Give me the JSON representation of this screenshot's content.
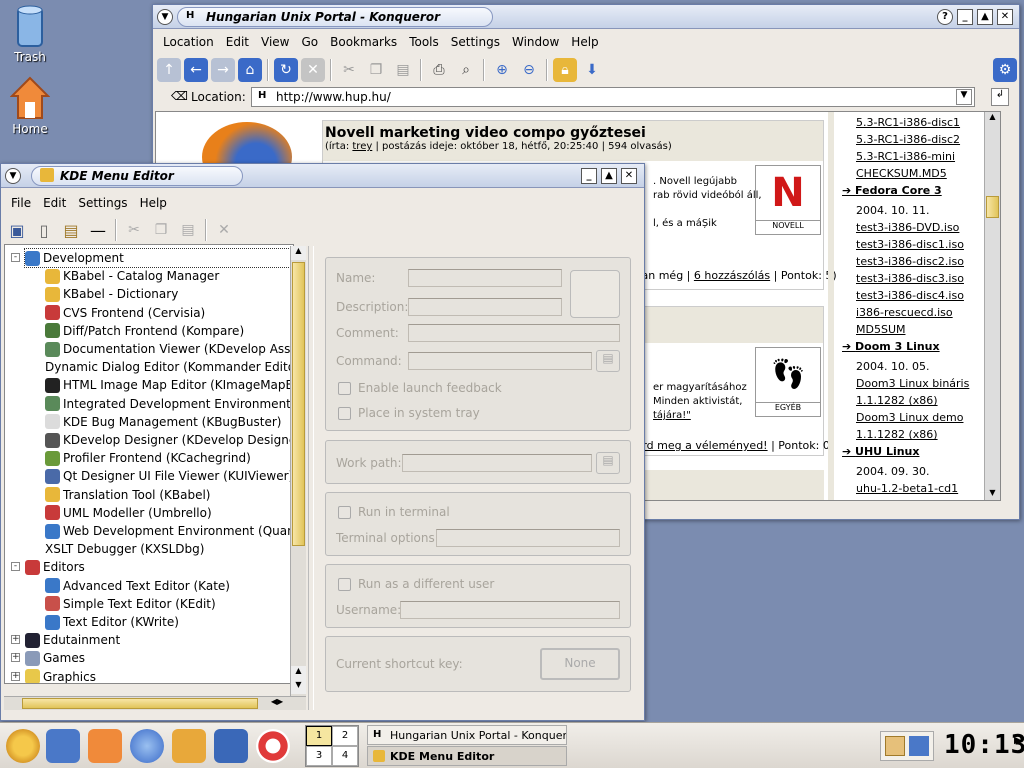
{
  "desktop": {
    "trash_label": "Trash",
    "home_label": "Home"
  },
  "konqueror": {
    "title": "Hungarian Unix Portal - Konqueror",
    "menu": [
      "Location",
      "Edit",
      "View",
      "Go",
      "Bookmarks",
      "Tools",
      "Settings",
      "Window",
      "Help"
    ],
    "location_label": "Location:",
    "url": "http://www.hup.hu/",
    "article1": {
      "title": "Novell marketing video compo győztesei",
      "meta_prefix": "(írta: ",
      "author": "trey",
      "meta_suffix": " | postázás ideje: október 18, hétfő, 20:25:40 | 594 olvasás)",
      "line1": ". Novell legújabb",
      "line2": "rab rövid videóból áll,",
      "line3": "l, és a máȘik",
      "badge": "NOVELL",
      "footer_prefix": "van még | ",
      "comments": "6 hozzászólás",
      "footer_suffix": " | Pontok: 5)"
    },
    "article2": {
      "title_tail": "s)",
      "line1": "er magyarításához",
      "line2": "Minden aktivistát,",
      "line3": "tájára!\"",
      "badge": "EGYÉB",
      "comment_link": "írd meg a véleményed!",
      "footer_suffix": " | Pontok: 0)",
      "tail": "e)"
    },
    "sidebar": {
      "items": [
        {
          "text": "5.3-RC1-i386-disc1",
          "type": "link"
        },
        {
          "text": "5.3-RC1-i386-disc2",
          "type": "link"
        },
        {
          "text": "5.3-RC1-i386-mini",
          "type": "link"
        },
        {
          "text": "CHECKSUM.MD5",
          "type": "link"
        },
        {
          "text": "Fedora Core 3",
          "type": "head"
        },
        {
          "text": "2004. 10. 11.",
          "type": "date"
        },
        {
          "text": "test3-i386-DVD.iso",
          "type": "link"
        },
        {
          "text": "test3-i386-disc1.iso",
          "type": "link"
        },
        {
          "text": "test3-i386-disc2.iso",
          "type": "link"
        },
        {
          "text": "test3-i386-disc3.iso",
          "type": "link"
        },
        {
          "text": "test3-i386-disc4.iso",
          "type": "link"
        },
        {
          "text": "i386-rescuecd.iso",
          "type": "link"
        },
        {
          "text": "MD5SUM",
          "type": "link"
        },
        {
          "text": "Doom 3 Linux",
          "type": "head"
        },
        {
          "text": "2004. 10. 05.",
          "type": "date"
        },
        {
          "text": "Doom3 Linux bináris",
          "type": "link"
        },
        {
          "text": "1.1.1282 (x86)",
          "type": "link"
        },
        {
          "text": "Doom3 Linux demo",
          "type": "link"
        },
        {
          "text": "1.1.1282 (x86)",
          "type": "link"
        },
        {
          "text": "UHU Linux",
          "type": "head"
        },
        {
          "text": "2004. 09. 30.",
          "type": "date"
        },
        {
          "text": "uhu-1.2-beta1-cd1",
          "type": "link"
        }
      ]
    }
  },
  "kmenuedit": {
    "title": "KDE Menu Editor",
    "menu": [
      "File",
      "Edit",
      "Settings",
      "Help"
    ],
    "tree": [
      {
        "label": "Development",
        "level": 0,
        "expander": "-",
        "color": "#3a78c8",
        "selected": true
      },
      {
        "label": "KBabel - Catalog Manager",
        "level": 1,
        "color": "#e8b73a"
      },
      {
        "label": "KBabel - Dictionary",
        "level": 1,
        "color": "#e8b73a"
      },
      {
        "label": "CVS Frontend (Cervisia)",
        "level": 1,
        "color": "#c83a3a"
      },
      {
        "label": "Diff/Patch Frontend (Kompare)",
        "level": 1,
        "color": "#4a7a3a"
      },
      {
        "label": "Documentation Viewer (KDevelop Assist",
        "level": 1,
        "color": "#5a8a5a"
      },
      {
        "label": "Dynamic Dialog Editor (Kommander Editor)",
        "level": 1,
        "color": ""
      },
      {
        "label": "HTML Image Map Editor (KImageMapEdi",
        "level": 1,
        "color": "#222"
      },
      {
        "label": "Integrated Development Environment (KD",
        "level": 1,
        "color": "#5a8a5a"
      },
      {
        "label": "KDE Bug Management (KBugBuster)",
        "level": 1,
        "color": "#dcdcdc"
      },
      {
        "label": "KDevelop Designer (KDevelop Designer",
        "level": 1,
        "color": "#555"
      },
      {
        "label": "Profiler Frontend (KCachegrind)",
        "level": 1,
        "color": "#6a9a3a"
      },
      {
        "label": "Qt Designer UI File Viewer (KUIViewer)",
        "level": 1,
        "color": "#4a6aa8"
      },
      {
        "label": "Translation Tool (KBabel)",
        "level": 1,
        "color": "#e8b73a"
      },
      {
        "label": "UML Modeller (Umbrello)",
        "level": 1,
        "color": "#c83a3a"
      },
      {
        "label": "Web Development Environment (Quanta",
        "level": 1,
        "color": "#3a78c8"
      },
      {
        "label": "XSLT Debugger (KXSLDbg)",
        "level": 1,
        "color": ""
      },
      {
        "label": "Editors",
        "level": 0,
        "expander": "-",
        "color": "#c83a3a"
      },
      {
        "label": "Advanced Text Editor (Kate)",
        "level": 1,
        "color": "#3a78c8"
      },
      {
        "label": "Simple Text Editor (KEdit)",
        "level": 1,
        "color": "#c8504a"
      },
      {
        "label": "Text Editor (KWrite)",
        "level": 1,
        "color": "#3a78c8"
      },
      {
        "label": "Edutainment",
        "level": 0,
        "expander": "+",
        "color": "#223"
      },
      {
        "label": "Games",
        "level": 0,
        "expander": "+",
        "color": "#8a9ab8"
      },
      {
        "label": "Graphics",
        "level": 0,
        "expander": "+",
        "color": "#e8c84a"
      },
      {
        "label": "Internet",
        "level": 0,
        "expander": "+",
        "color": "#3a68b8"
      }
    ],
    "form": {
      "name_label": "Name:",
      "description_label": "Description:",
      "comment_label": "Comment:",
      "command_label": "Command:",
      "launch_feedback_label": "Enable launch feedback",
      "system_tray_label": "Place in system tray",
      "work_path_label": "Work path:",
      "run_terminal_label": "Run in terminal",
      "terminal_options_label": "Terminal options:",
      "run_different_user_label": "Run as a different user",
      "username_label": "Username:",
      "shortcut_label": "Current shortcut key:",
      "shortcut_value": "None"
    }
  },
  "taskbar": {
    "pager": [
      "1",
      "2",
      "3",
      "4"
    ],
    "tasks": [
      "Hungarian Unix Portal - Konqueror",
      "KDE Menu Editor"
    ],
    "clock": "10:13"
  }
}
